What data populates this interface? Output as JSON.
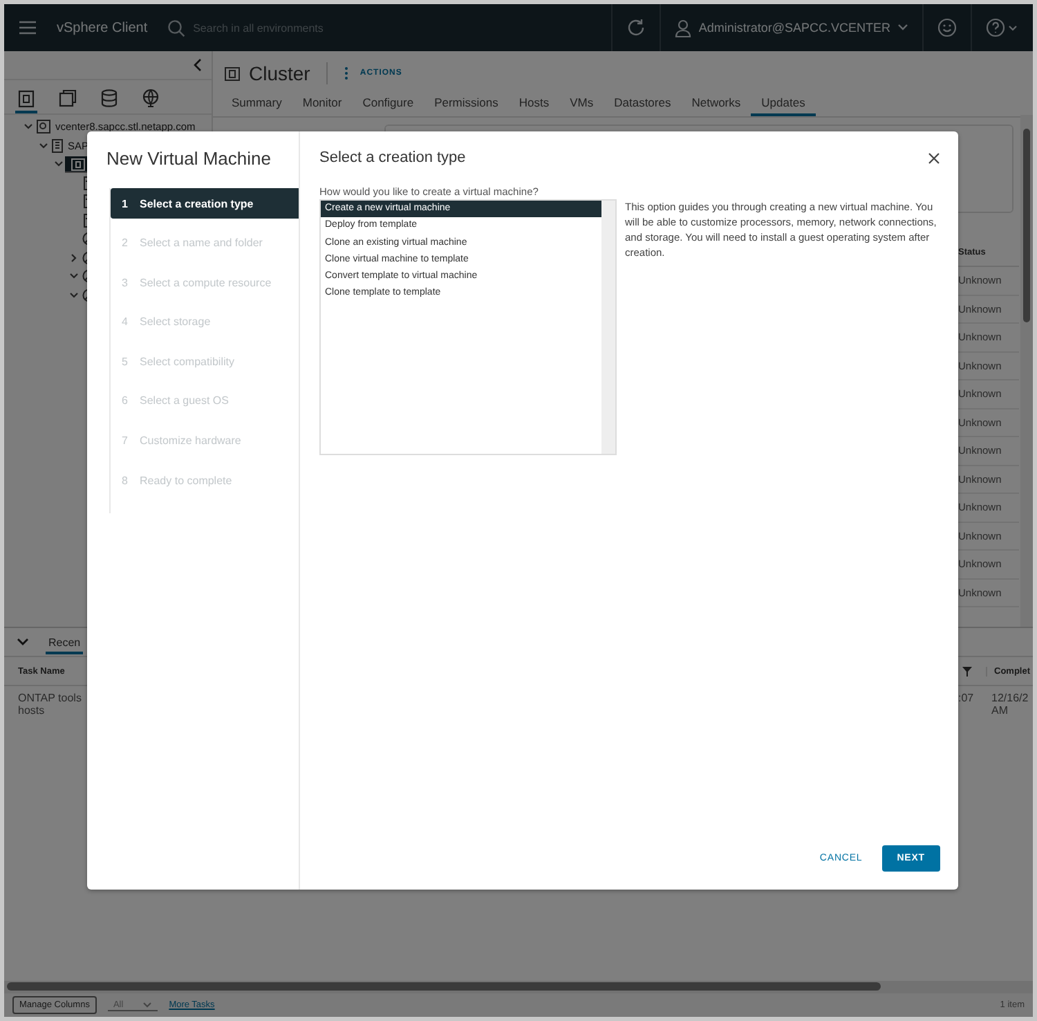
{
  "header": {
    "app_title": "vSphere Client",
    "search_placeholder": "Search in all environments",
    "user": "Administrator@SAPCC.VCENTER"
  },
  "sidebar": {
    "views": [
      {
        "kind": "hosts",
        "selected": true
      },
      {
        "kind": "vms",
        "selected": false
      },
      {
        "kind": "storage",
        "selected": false
      },
      {
        "kind": "network",
        "selected": false
      }
    ],
    "tree": [
      {
        "kind": "vcenter",
        "label": "vcenter8.sapcc.stl.netapp.com",
        "expanded": true,
        "selected": false,
        "children": [
          {
            "kind": "datacenter",
            "label": "SAP",
            "expanded": true,
            "selected": false,
            "children": [
              {
                "kind": "cluster",
                "expanded": true,
                "selected": true,
                "children": [
                  {
                    "kind": "host",
                    "selected": false
                  },
                  {
                    "kind": "host",
                    "selected": false
                  },
                  {
                    "kind": "host",
                    "selected": false
                  },
                  {
                    "kind": "pool",
                    "selected": false
                  },
                  {
                    "kind": "pool",
                    "expanded": false,
                    "selected": false
                  },
                  {
                    "kind": "pool",
                    "expanded": true,
                    "selected": false
                  },
                  {
                    "kind": "pool",
                    "expanded": true,
                    "selected": false
                  }
                ]
              }
            ]
          }
        ]
      }
    ]
  },
  "object": {
    "title": "Cluster",
    "actions": "ACTIONS",
    "tabs": [
      {
        "label": "Summary",
        "selected": false
      },
      {
        "label": "Monitor",
        "selected": false
      },
      {
        "label": "Configure",
        "selected": false
      },
      {
        "label": "Permissions",
        "selected": false
      },
      {
        "label": "Hosts",
        "selected": false
      },
      {
        "label": "VMs",
        "selected": false
      },
      {
        "label": "Datastores",
        "selected": false
      },
      {
        "label": "Networks",
        "selected": false
      },
      {
        "label": "Updates",
        "selected": true
      }
    ]
  },
  "status_table": {
    "column": "Status",
    "rows": [
      "Unknown",
      "Unknown",
      "Unknown",
      "Unknown",
      "Unknown",
      "Unknown",
      "Unknown",
      "Unknown",
      "Unknown",
      "Unknown",
      "Unknown",
      "Unknown"
    ]
  },
  "tasks": {
    "tab": "Recen",
    "columns": [
      "Task Name",
      "Complet"
    ],
    "row": {
      "task_name": [
        "ONTAP tools",
        "hosts"
      ],
      "column_3": ":07",
      "completed": [
        "12/16/2",
        "AM"
      ]
    }
  },
  "footer": {
    "manage_columns": "Manage Columns",
    "filter": "All",
    "more_tasks": "More Tasks",
    "count": "1 item"
  },
  "dialog": {
    "title": "New Virtual Machine",
    "steps": [
      {
        "number": "1",
        "label": "Select a creation type",
        "selected": true
      },
      {
        "number": "2",
        "label": "Select a name and folder",
        "selected": false
      },
      {
        "number": "3",
        "label": "Select a compute resource",
        "selected": false
      },
      {
        "number": "4",
        "label": "Select storage",
        "selected": false
      },
      {
        "number": "5",
        "label": "Select compatibility",
        "selected": false
      },
      {
        "number": "6",
        "label": "Select a guest OS",
        "selected": false
      },
      {
        "number": "7",
        "label": "Customize hardware",
        "selected": false
      },
      {
        "number": "8",
        "label": "Ready to complete",
        "selected": false
      }
    ],
    "page_title": "Select a creation type",
    "question": "How would you like to create a virtual machine?",
    "options": [
      {
        "label": "Create a new virtual machine",
        "selected": true
      },
      {
        "label": "Deploy from template",
        "selected": false
      },
      {
        "label": "Clone an existing virtual machine",
        "selected": false
      },
      {
        "label": "Clone virtual machine to template",
        "selected": false
      },
      {
        "label": "Convert template to virtual machine",
        "selected": false
      },
      {
        "label": "Clone template to template",
        "selected": false
      }
    ],
    "description": "This option guides you through creating a new virtual machine. You will be able to customize processors, memory, network connections, and storage. You will need to install a guest operating system after creation.",
    "buttons": {
      "cancel": "CANCEL",
      "next": "NEXT"
    }
  }
}
